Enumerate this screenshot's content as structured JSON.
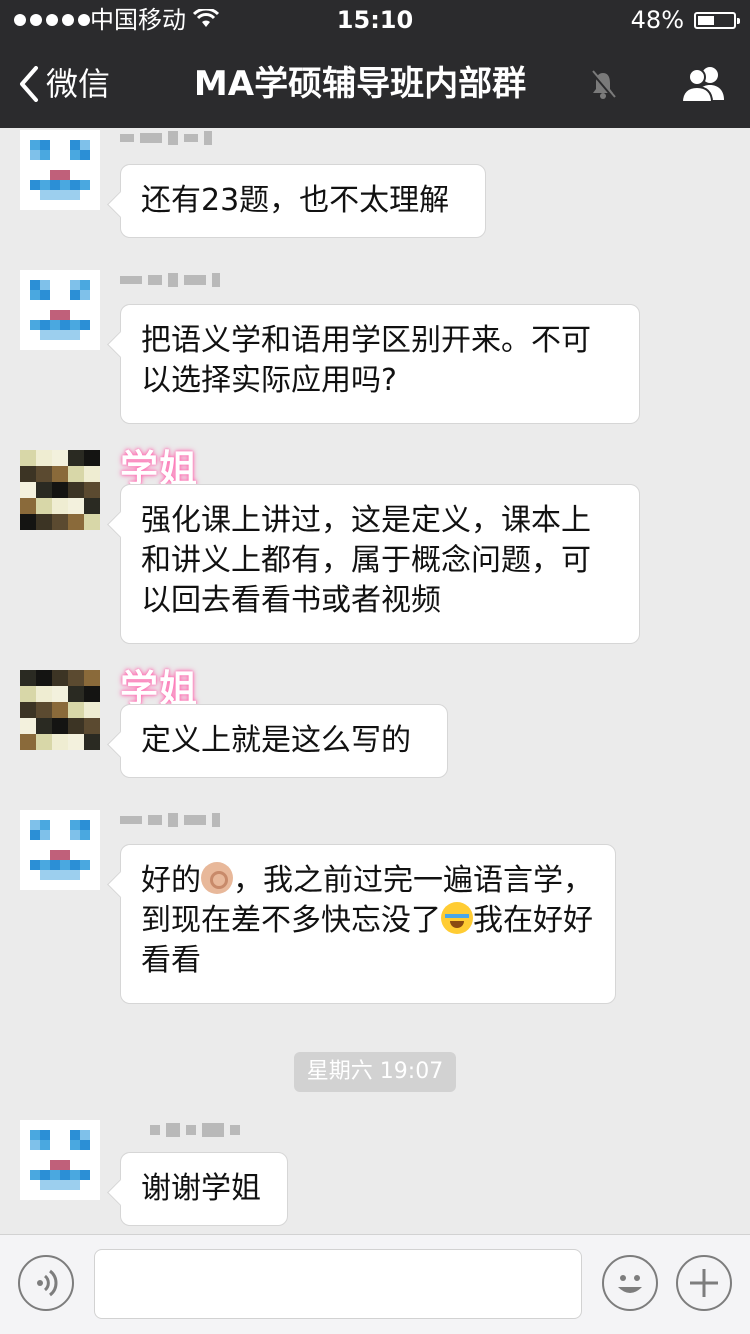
{
  "status_bar": {
    "carrier": "中国移动",
    "time": "15:10",
    "battery_percent_label": "48%",
    "battery_level": 0.48
  },
  "nav": {
    "back_label": "微信",
    "title": "MA学硕辅导班内部群"
  },
  "messages": [
    {
      "sender_label": "",
      "text": "还有23题，也不太理解"
    },
    {
      "sender_label": "",
      "text": "把语义学和语用学区别开来。不可以选择实际应用吗?"
    },
    {
      "sender_label": "学姐",
      "text": "强化课上讲过，这是定义，课本上和讲义上都有，属于概念问题，可以回去看看书或者视频"
    },
    {
      "sender_label": "学姐",
      "text": "定义上就是这么写的"
    },
    {
      "sender_label": "",
      "text_parts": [
        "好的",
        "，我之前过完一遍语言学，到现在差不多快忘没了",
        "我在好好看看"
      ],
      "emojis": [
        "ok-hand-emoji",
        "crying-laughing-emoji"
      ]
    },
    {
      "sender_label": "",
      "text": "谢谢学姐"
    }
  ],
  "timestamp": "星期六 19:07",
  "icons": [
    "signal-dots-icon",
    "wifi-icon",
    "battery-icon",
    "back-chevron-icon",
    "mute-bell-icon",
    "group-members-icon",
    "voice-icon",
    "emoji-icon",
    "plus-icon"
  ],
  "colors": {
    "nav_bg": "#2b2b2d",
    "chat_bg": "#ebebeb",
    "bubble_bg": "#ffffff",
    "sender_glow": "#ff6fb3",
    "timestamp_bg": "#d2d2d2"
  }
}
